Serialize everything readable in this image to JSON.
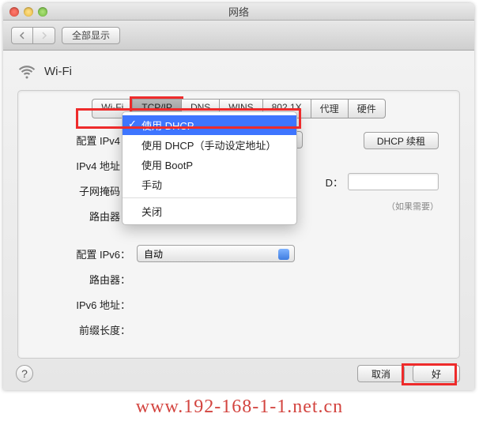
{
  "window": {
    "title": "网络"
  },
  "toolbar": {
    "show_all": "全部显示"
  },
  "header": {
    "title": "Wi-Fi"
  },
  "tabs": [
    {
      "label": "Wi-Fi"
    },
    {
      "label": "TCP/IP",
      "active": true,
      "highlighted": true
    },
    {
      "label": "DNS"
    },
    {
      "label": "WINS"
    },
    {
      "label": "802.1X"
    },
    {
      "label": "代理"
    },
    {
      "label": "硬件"
    }
  ],
  "form": {
    "configure_ipv4_label": "配置 IPv4：",
    "ipv4_address_label": "IPv4 地址：",
    "subnet_mask_label": "子网掩码：",
    "router_label": "路由器：",
    "configure_ipv6_label": "配置 IPv6：",
    "ipv6_router_label": "路由器：",
    "ipv6_address_label": "IPv6 地址：",
    "prefix_length_label": "前缀长度：",
    "ipv6_select_value": "自动"
  },
  "dropdown": {
    "items": [
      {
        "label": "使用 DHCP",
        "selected": true
      },
      {
        "label": "使用 DHCP（手动设定地址）"
      },
      {
        "label": "使用 BootP"
      },
      {
        "label": "手动"
      }
    ],
    "sep_after": 3,
    "close_label": "关闭"
  },
  "right": {
    "dhcp_renew": "DHCP 续租",
    "client_id_label": "D：",
    "hint": "（如果需要）"
  },
  "footer": {
    "cancel": "取消",
    "ok": "好"
  },
  "watermark": "www.192-168-1-1.net.cn"
}
